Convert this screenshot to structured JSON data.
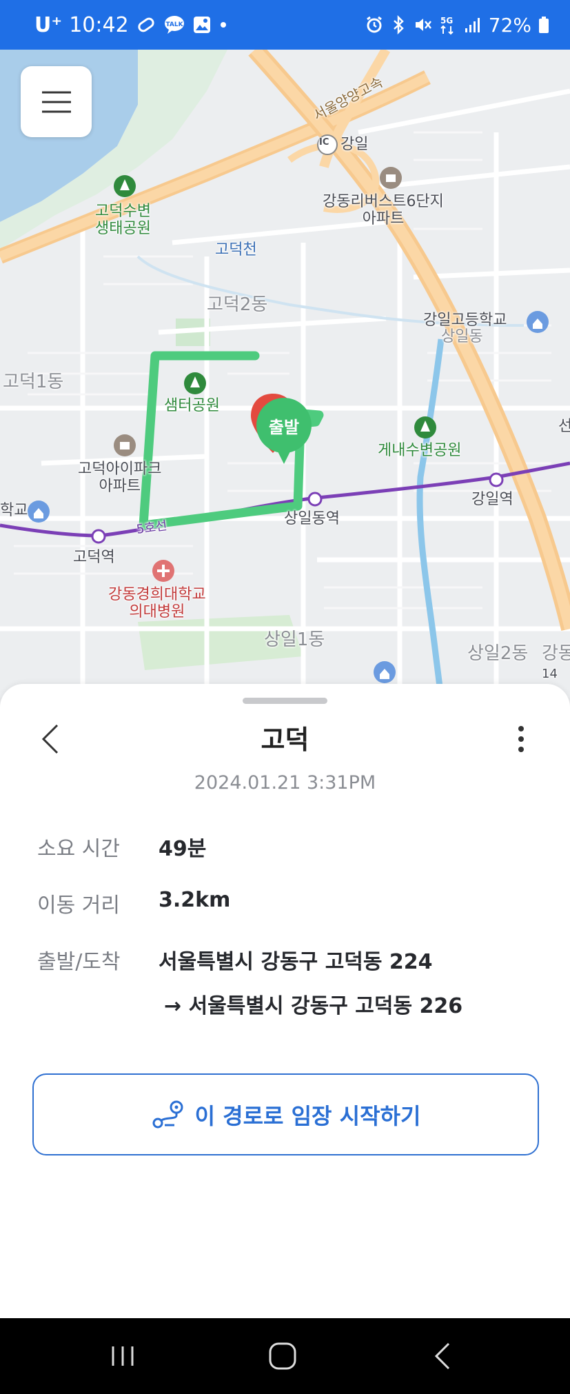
{
  "status_bar": {
    "carrier": "U⁺",
    "time": "10:42",
    "network": "5G",
    "battery": "72%"
  },
  "map": {
    "labels": {
      "highway": "서울양양고속",
      "ic": "IC",
      "gangil": "강일",
      "riverside_apt": "강동리버스트6단지\n아파트",
      "eco_park": "고덕수변\n생태공원",
      "stream": "고덕천",
      "district_godeok2": "고덕2동",
      "gangil_school": "강일고등학교",
      "district_sangil_top": "상일동",
      "district_godeok1": "고덕1동",
      "samteo_park": "샘터공원",
      "gyenae_park": "게내수변공원",
      "ipark_apt": "고덕아이파크\n아파트",
      "gangil_station": "강일역",
      "sangildong_station": "상일동역",
      "line5": "5호선",
      "godeok_station": "고덕역",
      "hospital": "강동경희대학교\n의대병원",
      "district_sangil1": "상일1동",
      "district_sangil2": "상일2동",
      "gangdong_partial": "강동",
      "school_partial": "학교",
      "seon_partial": "선",
      "route_num": "14"
    },
    "start_pin_label": "출발"
  },
  "sheet": {
    "title": "고덕",
    "date": "2024.01.21  3:31PM",
    "rows": [
      {
        "label": "소요 시간",
        "value": "49분"
      },
      {
        "label": "이동 거리",
        "value": "3.2km"
      },
      {
        "label": "출발/도착",
        "value": "서울특별시 강동구 고덕동 224",
        "value2": "→ 서울특별시 강동구 고덕동 226"
      }
    ],
    "start_button": "이 경로로 임장 시작하기"
  },
  "colors": {
    "status_bar": "#1f6fe6",
    "route": "#4ecb7e",
    "accent": "#2f70d1",
    "subway": "#7b3fb6"
  }
}
